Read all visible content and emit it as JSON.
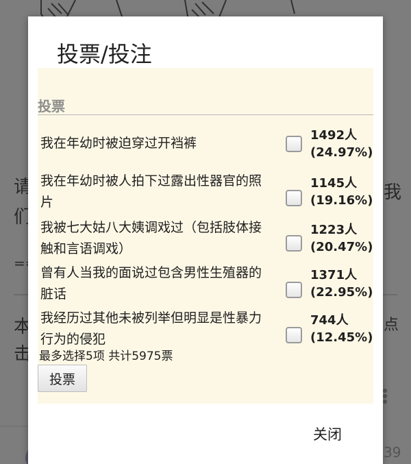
{
  "dialog": {
    "title": "投票/投注",
    "poll_heading": "投票",
    "options": [
      {
        "label": "我在年幼时被迫穿过开裆裤",
        "count": "1492人",
        "percent": "(24.97%)",
        "checked": false
      },
      {
        "label": "我在年幼时被人拍下过露出性器官的照片",
        "count": "1145人",
        "percent": "(19.16%)",
        "checked": false
      },
      {
        "label": "我被七大姑八大姨调戏过（包括肢体接触和言语调戏）",
        "count": "1223人",
        "percent": "(20.47%)",
        "checked": false
      },
      {
        "label": "曾有人当我的面说过包含男性生殖器的脏话",
        "count": "1371人",
        "percent": "(22.95%)",
        "checked": false
      },
      {
        "label": "我经历过其他未被列举但明显是性暴力行为的侵犯",
        "count": "744人",
        "percent": "(12.45%)",
        "checked": false
      }
    ],
    "footer": "最多选择5项 共计5975票",
    "vote_button": "投票",
    "close_button": "关闭"
  },
  "background": {
    "left_chars": [
      "请",
      "们",
      "本",
      "击"
    ],
    "right_chars": [
      "我",
      "点"
    ],
    "dashes": "==",
    "corner_number": "39"
  }
}
